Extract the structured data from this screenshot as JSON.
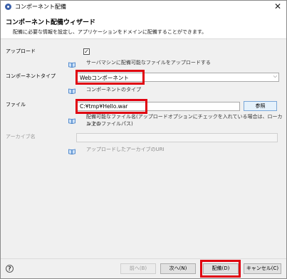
{
  "window": {
    "title": "コンポーネント配備",
    "close_glyph": "✕"
  },
  "header": {
    "title": "コンポーネント配備ウィザード",
    "description": "配備に必要な情報を設定し、アプリケーションをドメインに配備することができます。"
  },
  "upload": {
    "label": "アップロード",
    "checked_glyph": "✓",
    "hint": "サーバマシンに配備可能なファイルをアップロードする"
  },
  "component_type": {
    "label": "コンポーネントタイプ",
    "value": "Webコンポーネント",
    "hint": "コンポーネントのタイプ"
  },
  "file": {
    "label": "ファイル",
    "value": "C:¥tmp¥Hello.war",
    "browse_label": "参照",
    "hint_line1": "配備可能なファイル名(アップロードオプションにチェックを入れている場合は、ローカルマシ",
    "hint_line2": "ン上のファイルパス)"
  },
  "archive": {
    "label": "アーカイブ名",
    "hint": "アップロードしたアーカイブのURI"
  },
  "footer": {
    "help_glyph": "?",
    "back_label": "前へ(B)",
    "next_label": "次へ(N)",
    "deploy_label": "配備(D)",
    "cancel_label": "キャンセル(C)"
  },
  "colors": {
    "highlight": "#e0000f",
    "book_icon": "#3a7bc8"
  }
}
